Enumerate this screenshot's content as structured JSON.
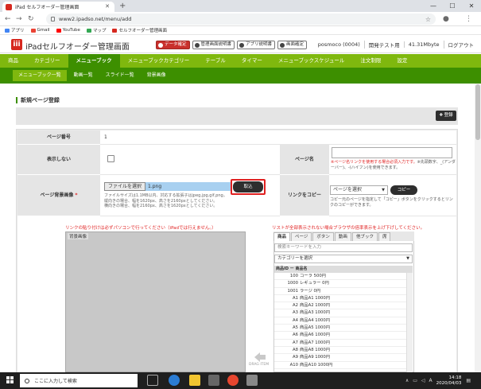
{
  "browser": {
    "tab_title": "iPad セルフオーダー管理画面",
    "new_tab": "+",
    "url": "www2.ipadso.net/menu/add",
    "bookmarks": [
      "アプリ",
      "Gmail",
      "YouTube",
      "マップ",
      "セルフオーダー管理画面"
    ],
    "bookmark_colors": [
      "#4285f4",
      "#ea4335",
      "#ff0000",
      "#34a853",
      "#d6281f"
    ]
  },
  "header": {
    "app_title": "iPadセルフオーダー管理画面",
    "buttons": [
      {
        "label": "データ確定",
        "variant": "red"
      },
      {
        "label": "管理画面説明書",
        "variant": "plain"
      },
      {
        "label": "アプリ説明書",
        "variant": "plain"
      },
      {
        "label": "画面確定",
        "variant": "plain"
      }
    ],
    "info": [
      "posmoco (0004)",
      "開発テスト用",
      "41.31Mbyte",
      "ログアウト"
    ]
  },
  "main_nav": {
    "items": [
      "商品",
      "カテゴリー",
      "メニューブック",
      "メニューブックカテゴリー",
      "テーブル",
      "タイマー",
      "メニューブックスケジュール",
      "注文制限",
      "設定"
    ],
    "active_index": 2
  },
  "sub_nav": {
    "items": [
      "メニューブック一覧",
      "動画一覧",
      "スライド一覧",
      "背景画像"
    ],
    "active_index": 0
  },
  "page": {
    "title": "新規ページ登録",
    "save_label": "登録"
  },
  "form": {
    "page_number_label": "ページ番号",
    "page_number_value": "1",
    "hide_label": "表示しない",
    "page_name_label": "ページ名",
    "page_name_note_red": "※ページ名リンクを使用する場合必須入力です。",
    "page_name_note": "※先頭数字、_(アンダーバー)、-(ハイフン)を使用できます。",
    "bg_image_label": "ページ背景画像",
    "required_mark": "*",
    "file_button": "ファイルを選択",
    "file_name": "1.png",
    "import_button": "取込",
    "file_note_lines": [
      "ファイルサイズは1.1MB以内、対応する拡張子はjpeg,jpg,gif,png。",
      "縦向きの場合、幅を1620px、高さを2160pxとしてください。",
      "横向きの場合、幅を2160px、高さを1620pxとしてください。"
    ],
    "link_copy_label": "リンクをコピー",
    "page_select": "ページを選択",
    "copy_button": "コピー",
    "copy_note": "コピー元のページを指定して「コピー」ボタンをクリックするとリンクのコピーができます。"
  },
  "editor": {
    "left_note": "リンクの貼り付けは必ずパソコンで行ってください（iPadでは行えません。）",
    "right_note": "リストが全部表示されない場合ブラウザの倍率表示を上げ下げしてください。",
    "canvas_label": "背景画像",
    "drag_label": "DRAG ITEM",
    "lib_tabs": [
      "商品",
      "ページ",
      "ボタン",
      "動画",
      "他ブック",
      "席"
    ],
    "lib_active_tab": 0,
    "search_placeholder": "検索キーワードを入力",
    "category_select": "カテゴリーを選択",
    "list_header": "商品ID ー 商品名",
    "items": [
      {
        "id": "100",
        "name": "コーラ 500円"
      },
      {
        "id": "1000",
        "name": "レギュラー 0円"
      },
      {
        "id": "1001",
        "name": "ラージ 0円"
      },
      {
        "id": "A1",
        "name": "商品A1 1000円"
      },
      {
        "id": "A2",
        "name": "商品A2 1000円"
      },
      {
        "id": "A3",
        "name": "商品A3 1000円"
      },
      {
        "id": "A4",
        "name": "商品A4 1000円"
      },
      {
        "id": "A5",
        "name": "商品A5 1000円"
      },
      {
        "id": "A6",
        "name": "商品A6 1000円"
      },
      {
        "id": "A7",
        "name": "商品A7 1000円"
      },
      {
        "id": "A8",
        "name": "商品A8 1000円"
      },
      {
        "id": "A9",
        "name": "商品A9 1000円"
      },
      {
        "id": "A10",
        "name": "商品A10 1000円"
      }
    ]
  },
  "taskbar": {
    "search_placeholder": "ここに入力して検索",
    "time": "14:18",
    "date": "2020/04/03",
    "ime": "A"
  },
  "colors": {
    "nav_green": "#7fb80e",
    "nav_dark_green": "#3d8f00",
    "accent_red": "#d6281f"
  }
}
